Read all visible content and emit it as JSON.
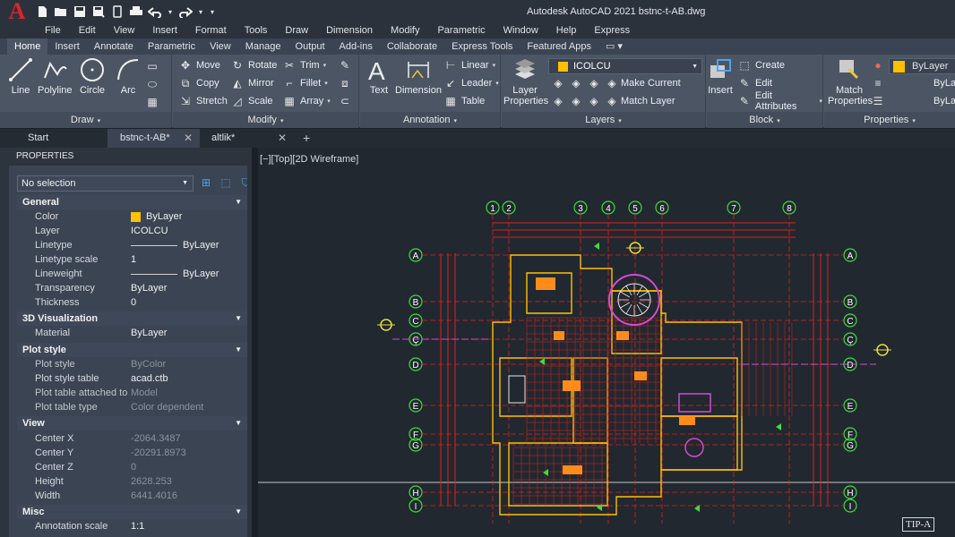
{
  "app": {
    "title": "Autodesk AutoCAD 2021    bstnc-t-AB.dwg",
    "logo": "A",
    "qat_icons": [
      "new-icon",
      "open-icon",
      "save-icon",
      "save-as-icon",
      "web-icon",
      "print-icon",
      "undo-icon",
      "redo-icon",
      "dropdown-icon"
    ]
  },
  "menu": [
    "File",
    "Edit",
    "View",
    "Insert",
    "Format",
    "Tools",
    "Draw",
    "Dimension",
    "Modify",
    "Parametric",
    "Window",
    "Help",
    "Express"
  ],
  "ribbon_tabs": [
    "Home",
    "Insert",
    "Annotate",
    "Parametric",
    "View",
    "Manage",
    "Output",
    "Add-ins",
    "Collaborate",
    "Express Tools",
    "Featured Apps"
  ],
  "ribbon": {
    "draw": {
      "title": "Draw",
      "line": "Line",
      "polyline": "Polyline",
      "circle": "Circle",
      "arc": "Arc"
    },
    "modify": {
      "title": "Modify",
      "move": "Move",
      "rotate": "Rotate",
      "trim": "Trim",
      "copy": "Copy",
      "mirror": "Mirror",
      "fillet": "Fillet",
      "stretch": "Stretch",
      "scale": "Scale",
      "array": "Array"
    },
    "annotation": {
      "title": "Annotation",
      "text": "Text",
      "dimension": "Dimension",
      "linear": "Linear",
      "leader": "Leader",
      "table": "Table"
    },
    "layers": {
      "title": "Layers",
      "layer_properties": "Layer Properties",
      "current_layer": "ICOLCU",
      "make_current": "Make Current",
      "match_layer": "Match Layer"
    },
    "block": {
      "title": "Block",
      "insert": "Insert",
      "create": "Create",
      "edit": "Edit",
      "edit_attributes": "Edit Attributes"
    },
    "properties": {
      "title": "Properties",
      "match_properties": "Match Properties",
      "color": "ByLayer",
      "linetype": "ByLa",
      "lineweight": "ByLa"
    }
  },
  "file_tabs": [
    {
      "label": "Start"
    },
    {
      "label": "bstnc-t-AB*"
    },
    {
      "label": "altlik*"
    }
  ],
  "palette": {
    "title": "PROPERTIES",
    "selection": "No selection",
    "sections": {
      "general": {
        "title": "General",
        "rows": [
          {
            "k": "Color",
            "v": "ByLayer"
          },
          {
            "k": "Layer",
            "v": "ICOLCU"
          },
          {
            "k": "Linetype",
            "v": "ByLayer"
          },
          {
            "k": "Linetype scale",
            "v": "1"
          },
          {
            "k": "Lineweight",
            "v": "ByLayer"
          },
          {
            "k": "Transparency",
            "v": "ByLayer"
          },
          {
            "k": "Thickness",
            "v": "0"
          }
        ]
      },
      "viz": {
        "title": "3D Visualization",
        "rows": [
          {
            "k": "Material",
            "v": "ByLayer"
          }
        ]
      },
      "plot": {
        "title": "Plot style",
        "rows": [
          {
            "k": "Plot style",
            "v": "ByColor"
          },
          {
            "k": "Plot style table",
            "v": "acad.ctb"
          },
          {
            "k": "Plot table attached to",
            "v": "Model"
          },
          {
            "k": "Plot table type",
            "v": "Color dependent"
          }
        ]
      },
      "view": {
        "title": "View",
        "rows": [
          {
            "k": "Center X",
            "v": "-2064.3487"
          },
          {
            "k": "Center Y",
            "v": "-20291.8973"
          },
          {
            "k": "Center Z",
            "v": "0"
          },
          {
            "k": "Height",
            "v": "2628.253"
          },
          {
            "k": "Width",
            "v": "6441.4016"
          }
        ]
      },
      "misc": {
        "title": "Misc",
        "rows": [
          {
            "k": "Annotation scale",
            "v": "1:1"
          }
        ]
      }
    }
  },
  "viewport": {
    "label": "[−][Top][2D Wireframe]",
    "grid_cols": [
      "1",
      "2",
      "3",
      "4",
      "5",
      "6",
      "7",
      "8"
    ],
    "grid_rows": [
      "A",
      "B",
      "C",
      "Ç",
      "D",
      "E",
      "F",
      "G",
      "H",
      "I"
    ],
    "stamp": "TIP-A"
  },
  "colors": {
    "accent_yellow": "#ffc000",
    "drawing_red": "#e0201c",
    "grid_green": "#3ddc3d"
  }
}
